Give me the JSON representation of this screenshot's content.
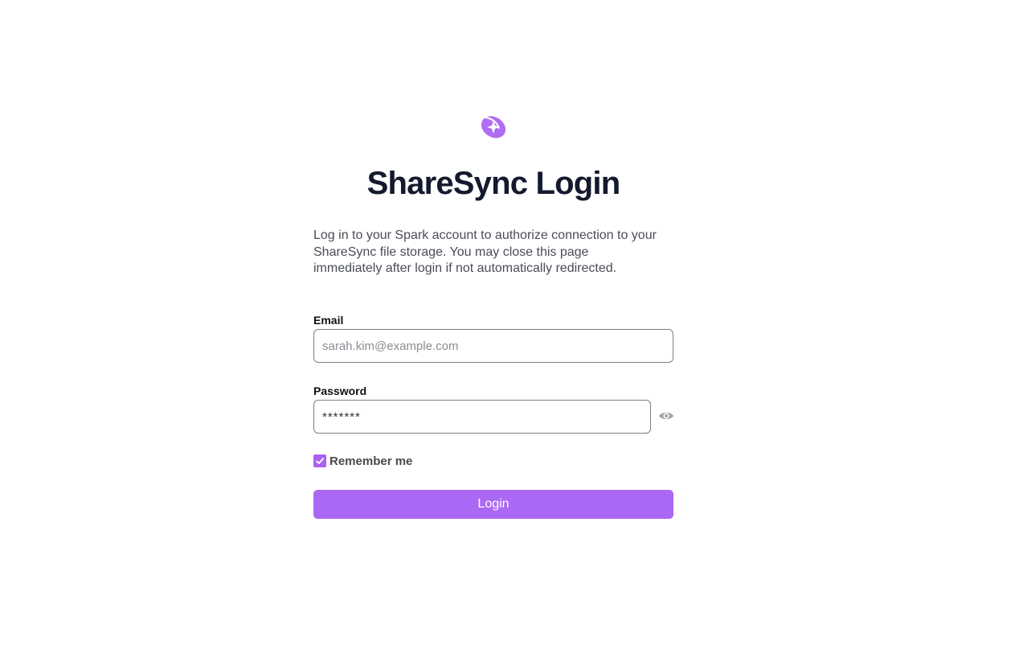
{
  "app": {
    "title": "ShareSync Login",
    "logo_icon": "spark-logo-icon",
    "brand_color": "#a862f0"
  },
  "intro": {
    "description": "Log in to your Spark account to authorize connection to your ShareSync file storage. You may close this page immediately after login if not automatically redirected."
  },
  "form": {
    "email": {
      "label": "Email",
      "placeholder": "sarah.kim@example.com",
      "value": ""
    },
    "password": {
      "label": "Password",
      "value": "*******",
      "toggle_icon": "eye-icon"
    },
    "remember": {
      "label": "Remember me",
      "checked": true,
      "icon": "checkmark-icon"
    },
    "submit": {
      "label": "Login"
    }
  }
}
